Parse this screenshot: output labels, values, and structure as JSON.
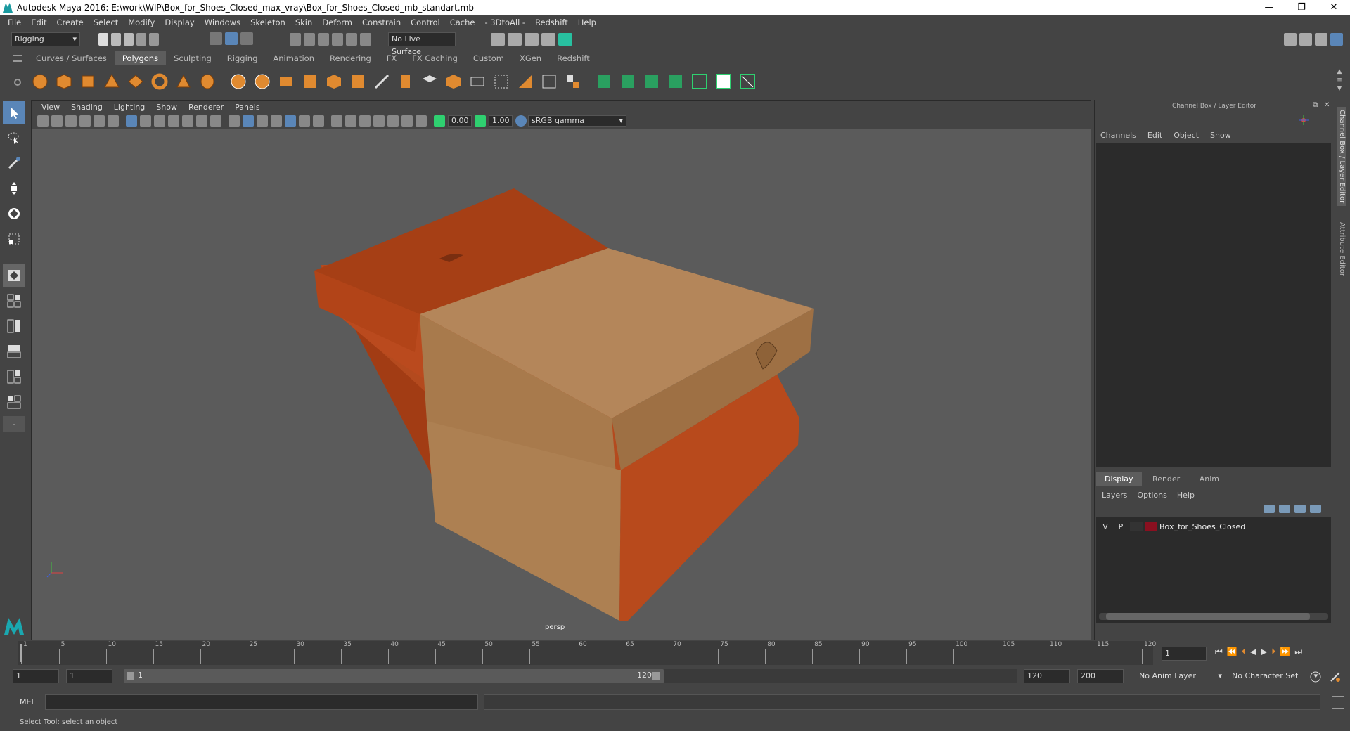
{
  "window": {
    "title": "Autodesk Maya 2016: E:\\work\\WIP\\Box_for_Shoes_Closed_max_vray\\Box_for_Shoes_Closed_mb_standart.mb",
    "minimize": "—",
    "maximize": "❐",
    "close": "✕"
  },
  "menubar": [
    "File",
    "Edit",
    "Create",
    "Select",
    "Modify",
    "Display",
    "Windows",
    "Skeleton",
    "Skin",
    "Deform",
    "Constrain",
    "Control",
    "Cache",
    "- 3DtoAll -",
    "Redshift",
    "Help"
  ],
  "statusline": {
    "mode": "Rigging",
    "live_surface": "No Live Surface"
  },
  "shelf": {
    "tabs": [
      "Curves / Surfaces",
      "Polygons",
      "Sculpting",
      "Rigging",
      "Animation",
      "Rendering",
      "FX",
      "FX Caching",
      "Custom",
      "XGen",
      "Redshift"
    ],
    "active_tab": "Polygons"
  },
  "viewport": {
    "menus": [
      "View",
      "Shading",
      "Lighting",
      "Show",
      "Renderer",
      "Panels"
    ],
    "exposure": "0.00",
    "gamma": "1.00",
    "colorspace": "sRGB gamma",
    "camera_label": "persp"
  },
  "channelbox": {
    "title": "Channel Box / Layer Editor",
    "menus": [
      "Channels",
      "Edit",
      "Object",
      "Show"
    ],
    "side_tabs": [
      "Channel Box / Layer Editor",
      "Attribute Editor"
    ]
  },
  "layer_editor": {
    "tabs": [
      "Display",
      "Render",
      "Anim"
    ],
    "active_tab": "Display",
    "menus": [
      "Layers",
      "Options",
      "Help"
    ],
    "layers": [
      {
        "v": "V",
        "p": "P",
        "color": "#8a1020",
        "name": "Box_for_Shoes_Closed"
      }
    ]
  },
  "timeline": {
    "ticks": [
      "1",
      "5",
      "10",
      "15",
      "20",
      "25",
      "30",
      "35",
      "40",
      "45",
      "50",
      "55",
      "60",
      "65",
      "70",
      "75",
      "80",
      "85",
      "90",
      "95",
      "100",
      "105",
      "110",
      "115",
      "120"
    ],
    "current_frame": "1"
  },
  "range": {
    "start": "1",
    "anim_start": "1",
    "slider_start": "1",
    "slider_end": "120",
    "end": "120",
    "anim_end": "200",
    "anim_layer": "No Anim Layer",
    "character_set": "No Character Set"
  },
  "cmdline": {
    "label": "MEL"
  },
  "helpline": {
    "text": "Select Tool: select an object"
  }
}
